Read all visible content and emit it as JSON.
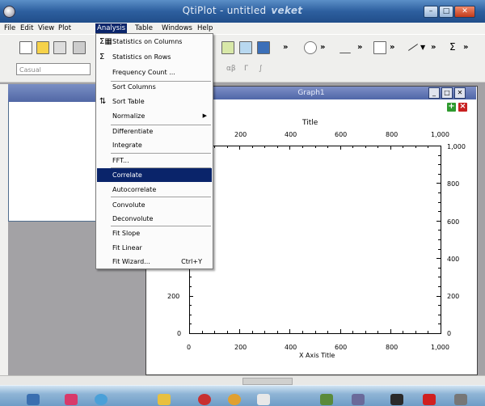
{
  "window": {
    "title": "QtiPlot - untitled",
    "brand": "veket"
  },
  "menubar": [
    "File",
    "Edit",
    "View",
    "Plot",
    "Analysis",
    "Table",
    "Windows",
    "Help"
  ],
  "toolbar": {
    "font_placeholder": "Casual",
    "more_symbol": "»",
    "alpha_beta": "αβ",
    "gamma": "Γ",
    "integral": "∫",
    "sigma": "Σ"
  },
  "analysis_menu": {
    "items": [
      {
        "label": "Statistics on Columns",
        "icon": "sigma-columns-icon"
      },
      {
        "label": "Statistics on Rows",
        "icon": "sigma-rows-icon"
      },
      {
        "label": "Frequency Count ..."
      },
      {
        "label": "Sort Columns"
      },
      {
        "label": "Sort Table",
        "icon": "sort-icon"
      },
      {
        "label": "Normalize",
        "submenu": true
      },
      {
        "label": "Differentiate"
      },
      {
        "label": "Integrate"
      },
      {
        "label": "FFT..."
      },
      {
        "label": "Correlate",
        "selected": true
      },
      {
        "label": "Autocorrelate"
      },
      {
        "label": "Convolute"
      },
      {
        "label": "Deconvolute"
      },
      {
        "label": "Fit Slope"
      },
      {
        "label": "Fit Linear"
      },
      {
        "label": "Fit Wizard...",
        "shortcut": "Ctrl+Y"
      }
    ]
  },
  "graph": {
    "window_title": "Graph1",
    "title": "Title",
    "x_axis_title": "X Axis Title",
    "x_ticks": [
      "0",
      "200",
      "400",
      "600",
      "800",
      "1,000"
    ],
    "y_ticks": [
      "0",
      "200",
      "400",
      "600",
      "800",
      "1,000"
    ],
    "top_ticks": [
      "200",
      "400",
      "600",
      "800",
      "1,000"
    ],
    "right_ticks": [
      "1,000",
      "800",
      "600",
      "400",
      "200",
      "0"
    ],
    "left_visible_ticks": [
      "200",
      "0"
    ]
  },
  "colors": {
    "menu_highlight": "#0a246a",
    "title_bar": "#2d5f9f"
  }
}
